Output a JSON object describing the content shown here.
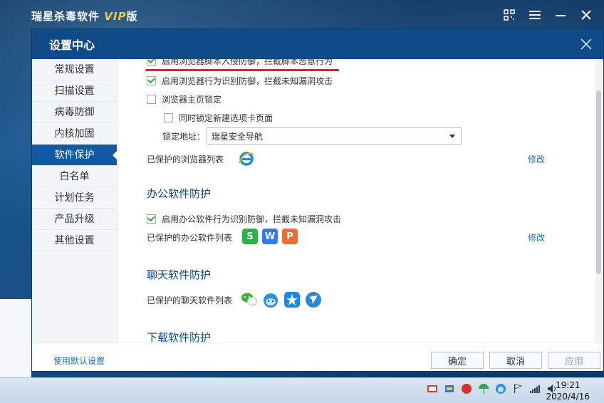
{
  "app": {
    "title_prefix": "瑞星杀毒软件",
    "title_vip": "VIP",
    "title_suffix": "版"
  },
  "dialog": {
    "title": "设置中心"
  },
  "sidebar": {
    "items": [
      {
        "label": "常规设置"
      },
      {
        "label": "扫描设置"
      },
      {
        "label": "病毒防御"
      },
      {
        "label": "内核加固"
      },
      {
        "label": "软件保护"
      },
      {
        "label": "白名单"
      },
      {
        "label": "计划任务"
      },
      {
        "label": "产品升级"
      },
      {
        "label": "其他设置"
      }
    ],
    "active_index": 4
  },
  "browser": {
    "opt1": "启用浏览器脚本入侵防御，拦截脚本恶意行为",
    "opt2": "启用浏览器行为识别防御，拦截未知漏洞攻击",
    "opt3": "浏览器主页锁定",
    "opt4": "同时锁定新建选项卡页面",
    "lock_label": "锁定地址：",
    "lock_value": "瑞星安全导航",
    "protected_label": "已保护的浏览器列表",
    "modify": "修改"
  },
  "office": {
    "title": "办公软件防护",
    "opt1": "启用办公软件行为识别防御，拦截未知漏洞攻击",
    "protected_label": "已保护的办公软件列表",
    "modify": "修改",
    "icons": [
      "S",
      "W",
      "P"
    ]
  },
  "chat": {
    "title": "聊天软件防护",
    "protected_label": "已保护的聊天软件列表"
  },
  "download": {
    "title": "下载软件防护"
  },
  "footer": {
    "default_link": "使用默认设置",
    "ok": "确定",
    "cancel": "取消",
    "apply": "应用"
  },
  "taskbar": {
    "time": "19:21",
    "date": "2020/4/16"
  },
  "colors": {
    "header": "#0f4a86",
    "active_tab": "#0f5aa3",
    "link": "#1a6fc0",
    "check": "#35a540",
    "wps_s": "#2bb34a",
    "wps_w": "#2d7cf6",
    "wps_p": "#f06a35"
  }
}
